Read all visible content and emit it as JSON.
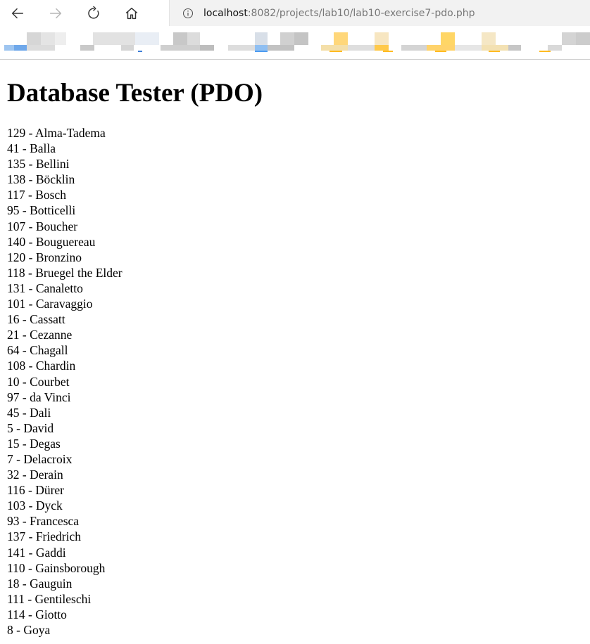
{
  "browser": {
    "url_host": "localhost",
    "url_rest": ":8082/projects/lab10/lab10-exercise7-pdo.php"
  },
  "page": {
    "title": "Database Tester (PDO)",
    "artists": [
      {
        "id": "129",
        "name": "Alma-Tadema"
      },
      {
        "id": "41",
        "name": "Balla"
      },
      {
        "id": "135",
        "name": "Bellini"
      },
      {
        "id": "138",
        "name": "Böcklin"
      },
      {
        "id": "117",
        "name": "Bosch"
      },
      {
        "id": "95",
        "name": "Botticelli"
      },
      {
        "id": "107",
        "name": "Boucher"
      },
      {
        "id": "140",
        "name": "Bouguereau"
      },
      {
        "id": "120",
        "name": "Bronzino"
      },
      {
        "id": "118",
        "name": "Bruegel the Elder"
      },
      {
        "id": "131",
        "name": "Canaletto"
      },
      {
        "id": "101",
        "name": "Caravaggio"
      },
      {
        "id": "16",
        "name": "Cassatt"
      },
      {
        "id": "21",
        "name": "Cezanne"
      },
      {
        "id": "64",
        "name": "Chagall"
      },
      {
        "id": "108",
        "name": "Chardin"
      },
      {
        "id": "10",
        "name": "Courbet"
      },
      {
        "id": "97",
        "name": "da Vinci"
      },
      {
        "id": "45",
        "name": "Dali"
      },
      {
        "id": "5",
        "name": "David"
      },
      {
        "id": "15",
        "name": "Degas"
      },
      {
        "id": "7",
        "name": "Delacroix"
      },
      {
        "id": "32",
        "name": "Derain"
      },
      {
        "id": "116",
        "name": "Dürer"
      },
      {
        "id": "103",
        "name": "Dyck"
      },
      {
        "id": "93",
        "name": "Francesca"
      },
      {
        "id": "137",
        "name": "Friedrich"
      },
      {
        "id": "141",
        "name": "Gaddi"
      },
      {
        "id": "110",
        "name": "Gainsborough"
      },
      {
        "id": "18",
        "name": "Gauguin"
      },
      {
        "id": "111",
        "name": "Gentileschi"
      },
      {
        "id": "114",
        "name": "Giotto"
      },
      {
        "id": "8",
        "name": "Goya"
      }
    ]
  },
  "icons": {
    "back": "arrow-left-icon",
    "forward": "arrow-right-icon",
    "refresh": "refresh-icon",
    "home": "home-icon",
    "info": "info-icon"
  },
  "colors": {
    "page_background": "#ffffff",
    "address_bar_background": "#f2f2f2",
    "text": "#000000",
    "url_rest": "#777777"
  }
}
